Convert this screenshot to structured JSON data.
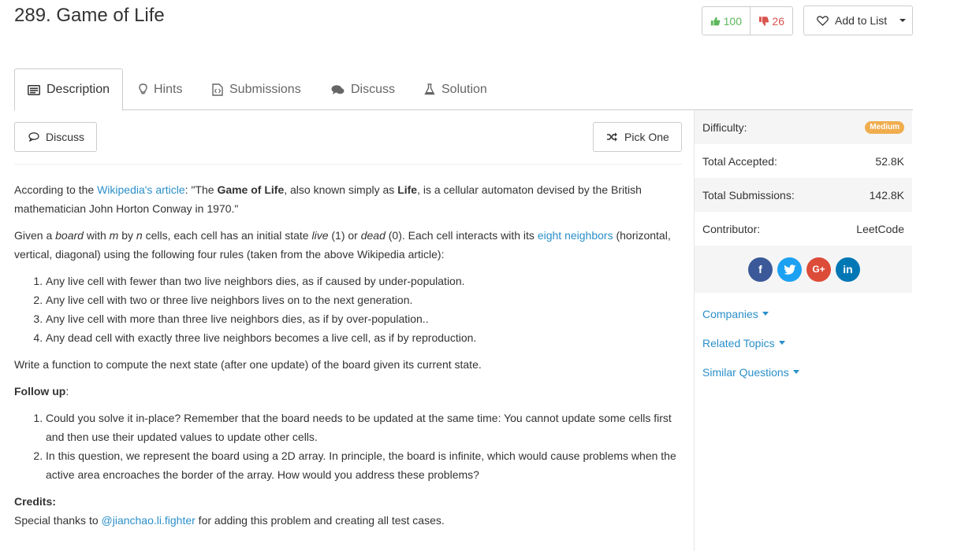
{
  "problem": {
    "title": "289. Game of Life",
    "upvotes": "100",
    "downvotes": "26",
    "add_to_list": "Add to List"
  },
  "tabs": [
    {
      "label": "Description",
      "icon": "description-icon"
    },
    {
      "label": "Hints",
      "icon": "lightbulb-icon"
    },
    {
      "label": "Submissions",
      "icon": "code-file-icon"
    },
    {
      "label": "Discuss",
      "icon": "comments-icon"
    },
    {
      "label": "Solution",
      "icon": "flask-icon"
    }
  ],
  "toolbar": {
    "discuss_label": "Discuss",
    "pick_one_label": "Pick One"
  },
  "description": {
    "p1_a": "According to the ",
    "p1_link": "Wikipedia's article",
    "p1_b": ": \"The ",
    "p1_bold1": "Game of Life",
    "p1_c": ", also known simply as ",
    "p1_bold2": "Life",
    "p1_d": ", is a cellular automaton devised by the British mathematician John Horton Conway in 1970.\"",
    "p2_a": "Given a ",
    "p2_board": "board",
    "p2_b": " with ",
    "p2_m": "m",
    "p2_c": " by ",
    "p2_n": "n",
    "p2_d": " cells, each cell has an initial state ",
    "p2_live": "live",
    "p2_e": " (1) or ",
    "p2_dead": "dead",
    "p2_f": " (0). Each cell interacts with its ",
    "p2_link": "eight neighbors",
    "p2_g": " (horizontal, vertical, diagonal) using the following four rules (taken from the above Wikipedia article):",
    "rules": [
      "Any live cell with fewer than two live neighbors dies, as if caused by under-population.",
      "Any live cell with two or three live neighbors lives on to the next generation.",
      "Any live cell with more than three live neighbors dies, as if by over-population..",
      "Any dead cell with exactly three live neighbors becomes a live cell, as if by reproduction."
    ],
    "p3": "Write a function to compute the next state (after one update) of the board given its current state.",
    "followup_label": "Follow up",
    "followup_colon": ":",
    "followups": [
      "Could you solve it in-place? Remember that the board needs to be updated at the same time: You cannot update some cells first and then use their updated values to update other cells.",
      "In this question, we represent the board using a 2D array. In principle, the board is infinite, which would cause problems when the active area encroaches the border of the array. How would you address these problems?"
    ],
    "credits_label": "Credits:",
    "credits_a": "Special thanks to ",
    "credits_link": "@jianchao.li.fighter",
    "credits_b": " for adding this problem and creating all test cases."
  },
  "sidebar": {
    "difficulty_label": "Difficulty:",
    "difficulty_value": "Medium",
    "accepted_label": "Total Accepted:",
    "accepted_value": "52.8K",
    "submissions_label": "Total Submissions:",
    "submissions_value": "142.8K",
    "contributor_label": "Contributor:",
    "contributor_value": "LeetCode",
    "social": [
      {
        "icon": "facebook-icon",
        "glyph": "f",
        "color": "#3b5998"
      },
      {
        "icon": "twitter-icon",
        "glyph": "t",
        "color": "#1da1f2"
      },
      {
        "icon": "google-plus-icon",
        "glyph": "G+",
        "color": "#dd4b39"
      },
      {
        "icon": "linkedin-icon",
        "glyph": "in",
        "color": "#0077b5"
      }
    ],
    "companies": "Companies",
    "related_topics": "Related Topics",
    "similar_questions": "Similar Questions"
  },
  "colors": {
    "link": "#2a8fc9",
    "upvote": "#5cb85c",
    "downvote": "#d9534f",
    "medium_badge": "#f0ad4e"
  }
}
